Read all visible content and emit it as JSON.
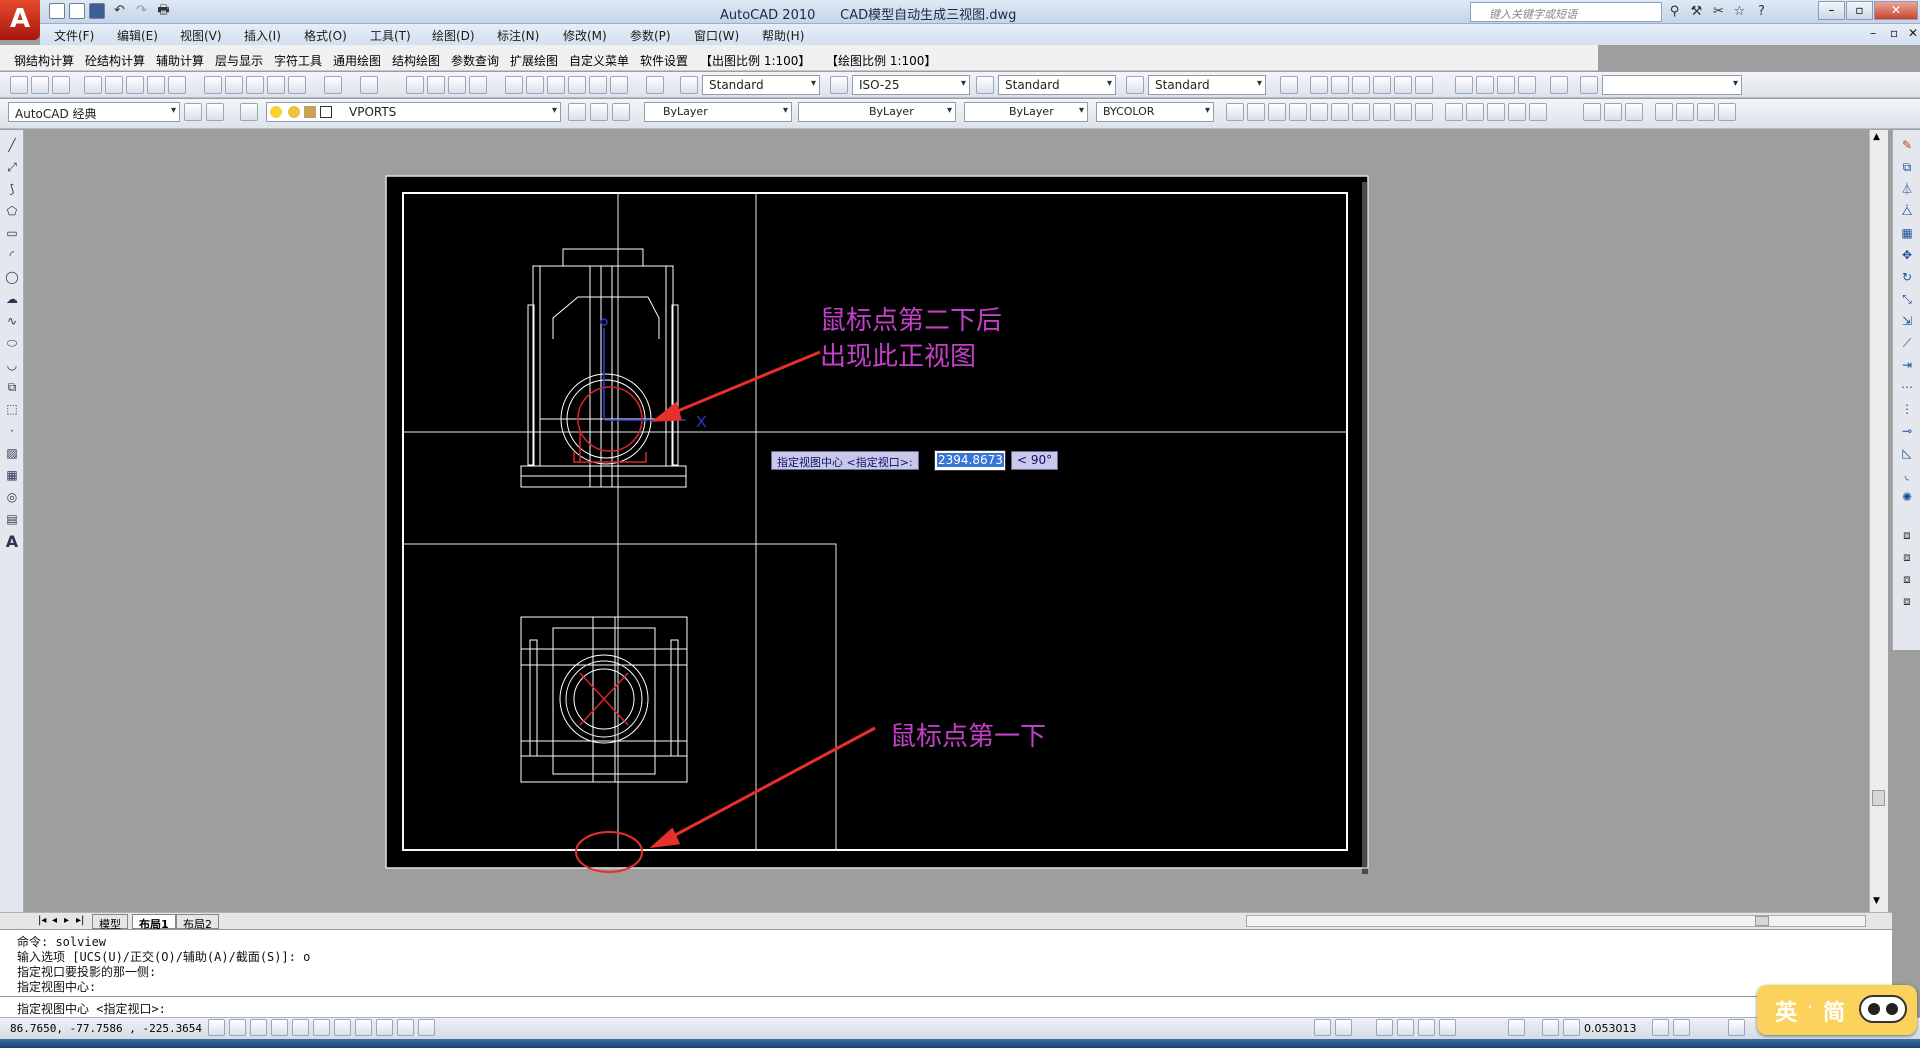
{
  "app": {
    "logo_letter": "A",
    "title": "AutoCAD 2010      CAD模型自动生成三视图.dwg",
    "help_search_placeholder": "键入关键字或短语"
  },
  "menubar": {
    "items": [
      "文件(F)",
      "编辑(E)",
      "视图(V)",
      "插入(I)",
      "格式(O)",
      "工具(T)",
      "绘图(D)",
      "标注(N)",
      "修改(M)",
      "参数(P)",
      "窗口(W)",
      "帮助(H)"
    ]
  },
  "custom_toolbar": {
    "items": [
      "钢结构计算",
      "砼结构计算",
      "辅助计算",
      "层与显示",
      "字符工具",
      "通用绘图",
      "结构绘图",
      "参数查询",
      "扩展绘图",
      "自定义菜单",
      "软件设置",
      "【出图比例 1:100】",
      "【绘图比例 1:100】"
    ]
  },
  "styles_toolbar": {
    "text_style": "Standard",
    "dim_style": "ISO-25",
    "table_style": "Standard",
    "multileader_style": "Standard"
  },
  "workspace_toolbar": {
    "workspace": "AutoCAD 经典",
    "layer": "VPORTS",
    "color": "ByLayer",
    "linetype": "ByLayer",
    "lineweight": "ByLayer",
    "plotstyle": "BYCOLOR"
  },
  "drawing": {
    "annotation_top": [
      "鼠标点第二下后",
      "出现此正视图"
    ],
    "annotation_bottom": "鼠标点第一下",
    "ucs_x_label": "X",
    "ucs_y_label": "Y",
    "accent_color": "#c23fc8",
    "arrow_color": "#e8302a"
  },
  "dynamic_input": {
    "prompt": "指定视图中心 <指定视口>:",
    "value": "2394.8673",
    "angle": "< 90°"
  },
  "layout_tabs": [
    "模型",
    "布局1",
    "布局2"
  ],
  "active_tab": "布局1",
  "command_history": [
    "命令: solview",
    "输入选项 [UCS(U)/正交(O)/辅助(A)/截面(S)]: o",
    "指定视口要投影的那一侧:",
    "指定视图中心:"
  ],
  "command_prompt": "指定视图中心 <指定视口>:",
  "status": {
    "coordinates": "86.7650, -77.7586 , -225.3654",
    "scale": "0.053013",
    "ime_lang": "英",
    "ime_mode": "简"
  }
}
